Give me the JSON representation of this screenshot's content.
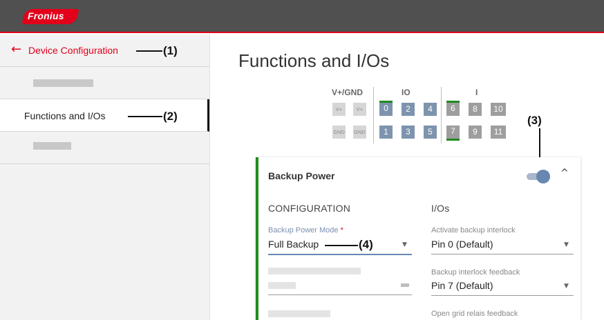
{
  "header": {
    "logo_text": "Fronius"
  },
  "sidebar": {
    "back_label": "Device Configuration",
    "active_item_label": "Functions and I/Os",
    "callout_1": "(1)",
    "callout_2": "(2)"
  },
  "main": {
    "title": "Functions and I/Os",
    "io_panel": {
      "groups": {
        "vgnd": "V+/GND",
        "io": "IO",
        "i": "I"
      },
      "vplus_label": "V+",
      "gnd_label": "GND",
      "pins_top": [
        "0",
        "2",
        "4",
        "6",
        "8",
        "10"
      ],
      "pins_bottom": [
        "1",
        "3",
        "5",
        "7",
        "9",
        "11"
      ]
    },
    "callout_3": "(3)",
    "card": {
      "title": "Backup Power",
      "toggle_on": true,
      "configuration_heading": "CONFIGURATION",
      "ios_heading": "I/Os",
      "backup_mode_label": "Backup Power Mode",
      "required_mark": "*",
      "backup_mode_value": "Full Backup",
      "callout_4": "(4)",
      "interlock_label": "Activate backup interlock",
      "interlock_value": "Pin 0 (Default)",
      "feedback_label": "Backup interlock feedback",
      "feedback_value": "Pin 7 (Default)",
      "grid_relais_label": "Open grid relais feedback"
    }
  },
  "colors": {
    "brand_red": "#e2001a",
    "header_gray": "#505050",
    "accent_green": "#1f8a1f",
    "io_blue": "#7e93ad",
    "input_gray": "#9e9e9e"
  }
}
